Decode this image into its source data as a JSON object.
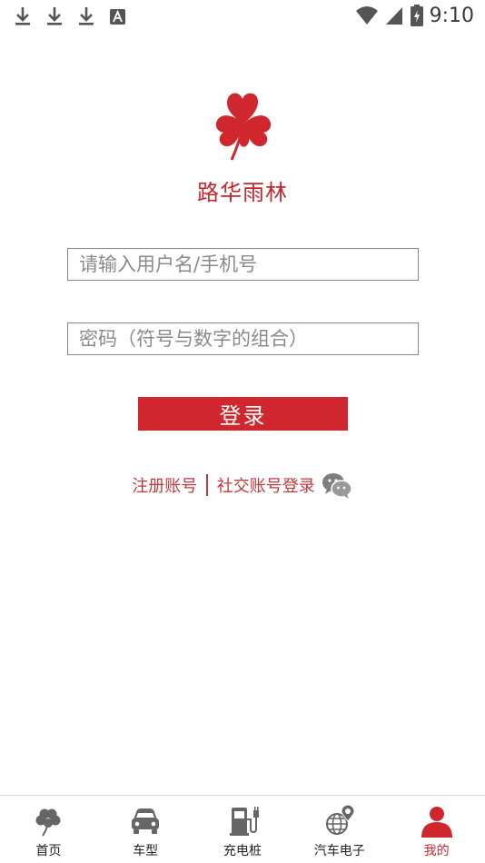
{
  "status_bar": {
    "time": "9:10",
    "left_icons": [
      "download-icon",
      "download-icon",
      "download-icon",
      "font-a-icon"
    ],
    "right_icons": [
      "wifi-icon",
      "signal-icon",
      "battery-charging-icon"
    ]
  },
  "brand": {
    "name": "路华雨林",
    "logo_icon": "four-leaf-clover-icon",
    "accent_color": "#d0272e"
  },
  "login": {
    "username_placeholder": "请输入用户名/手机号",
    "password_placeholder": "密码（符号与数字的组合）",
    "submit_label": "登录"
  },
  "links": {
    "register": "注册账号",
    "social_login": "社交账号登录",
    "social_icon": "wechat-icon"
  },
  "bottom_nav": {
    "items": [
      {
        "label": "首页",
        "icon": "clover-icon",
        "active": false
      },
      {
        "label": "车型",
        "icon": "car-icon",
        "active": false
      },
      {
        "label": "充电桩",
        "icon": "charging-station-icon",
        "active": false
      },
      {
        "label": "汽车电子",
        "icon": "globe-pin-icon",
        "active": false
      },
      {
        "label": "我的",
        "icon": "user-icon",
        "active": true
      }
    ]
  }
}
